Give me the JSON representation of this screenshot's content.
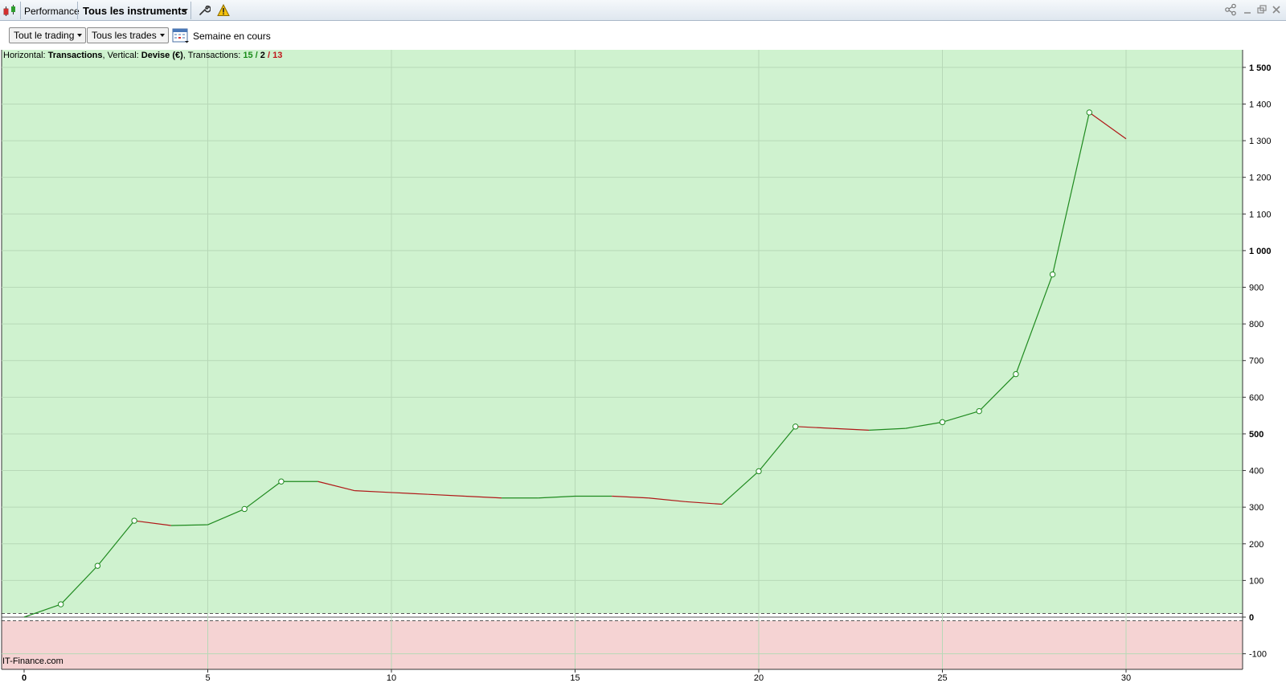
{
  "titlebar": {
    "performance_label": "Performance",
    "instruments_label": "Tous les instruments"
  },
  "toolbar": {
    "trading_select": "Tout le trading",
    "trades_select": "Tous les trades",
    "period_label": "Semaine en cours"
  },
  "info": {
    "horizontal_prefix": "Horizontal: ",
    "horizontal_value": "Transactions",
    "vertical_prefix": ", Vertical: ",
    "vertical_value": "Devise (€)",
    "transactions_prefix": ", Transactions: ",
    "count_green": "15",
    "sep1": " / ",
    "count_black": "2",
    "sep2": " / ",
    "count_red": "13"
  },
  "brand": "IT-Finance.com",
  "colors": {
    "profit_zone": "#cff2cf",
    "loss_zone": "#f5d3d3",
    "gain_line": "#1f8a1f",
    "loss_line": "#b01818",
    "grid": "#b7d8b7"
  },
  "chart_data": {
    "type": "line",
    "x": [
      0,
      1,
      2,
      3,
      4,
      5,
      6,
      7,
      8,
      9,
      10,
      11,
      12,
      13,
      14,
      15,
      16,
      17,
      18,
      19,
      20,
      21,
      22,
      23,
      24,
      25,
      26,
      27,
      28,
      29,
      30
    ],
    "values": [
      0,
      35,
      140,
      263,
      250,
      252,
      295,
      370,
      370,
      345,
      340,
      335,
      330,
      325,
      325,
      330,
      330,
      325,
      315,
      308,
      398,
      520,
      515,
      510,
      515,
      532,
      562,
      663,
      935,
      1377,
      1305
    ],
    "markers_at": [
      1,
      2,
      3,
      6,
      7,
      20,
      21,
      25,
      26,
      27,
      28,
      29
    ],
    "xlim": [
      0,
      32.5
    ],
    "ylim": [
      -130,
      1510
    ],
    "x_ticks": [
      "0",
      "5",
      "10",
      "15",
      "20",
      "25",
      "30"
    ],
    "x_tick_values": [
      0,
      5,
      10,
      15,
      20,
      25,
      30
    ],
    "y_ticks": [
      "-100",
      "0",
      "100",
      "200",
      "300",
      "400",
      "500",
      "600",
      "700",
      "800",
      "900",
      "1 000",
      "1 100",
      "1 200",
      "1 300",
      "1 400",
      "1 500"
    ],
    "y_tick_values": [
      -100,
      0,
      100,
      200,
      300,
      400,
      500,
      600,
      700,
      800,
      900,
      1000,
      1100,
      1200,
      1300,
      1400,
      1500
    ],
    "y_bold_ticks": [
      0,
      500,
      1000,
      1500
    ],
    "x_gridlines": [
      5,
      10,
      15,
      20,
      25,
      30
    ],
    "grid": true
  }
}
